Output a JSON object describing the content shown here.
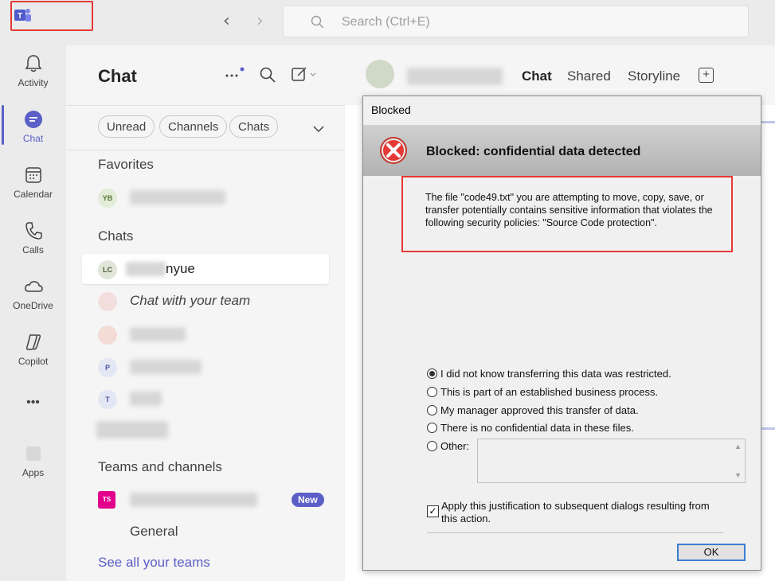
{
  "titlebar": {
    "search_placeholder": "Search (Ctrl+E)",
    "back_arrow": "‹",
    "forward_arrow": "›"
  },
  "rail": {
    "items": [
      {
        "label": "Activity",
        "icon": "bell-icon"
      },
      {
        "label": "Chat",
        "icon": "chat-icon"
      },
      {
        "label": "Calendar",
        "icon": "calendar-icon"
      },
      {
        "label": "Calls",
        "icon": "phone-icon"
      },
      {
        "label": "OneDrive",
        "icon": "cloud-icon"
      },
      {
        "label": "Copilot",
        "icon": "copilot-icon"
      },
      {
        "label": "Apps",
        "icon": "apps-icon"
      }
    ],
    "more": "•••"
  },
  "panel": {
    "title": "Chat",
    "filters": [
      "Unread",
      "Channels",
      "Chats"
    ],
    "favorites_header": "Favorites",
    "chats_header": "Chats",
    "teams_header": "Teams and channels",
    "favorites": [
      {
        "initials": "YB",
        "name": ""
      }
    ],
    "chats": [
      {
        "initials": "LC",
        "name": "nyue"
      },
      {
        "initials": "",
        "name": "Chat with your team"
      },
      {
        "initials": "",
        "name": ""
      },
      {
        "initials": "P",
        "name": ""
      },
      {
        "initials": "T",
        "name": ""
      },
      {
        "initials": "",
        "name": ""
      }
    ],
    "team": {
      "initials": "TS",
      "badge": "New",
      "channel": "General"
    },
    "see_all": "See all your teams"
  },
  "main": {
    "tabs": [
      "Chat",
      "Shared",
      "Storyline"
    ],
    "add_tab": "+"
  },
  "dialog": {
    "title": "Blocked",
    "heading": "Blocked: confidential data detected",
    "message": "The file \"code49.txt\" you are attempting to move, copy, save, or transfer potentially contains sensitive information that violates the following security policies: \"Source Code protection\".",
    "options": [
      {
        "label": "I did not know transferring this data was restricted.",
        "checked": true
      },
      {
        "label": "This is part of an established business process.",
        "checked": false
      },
      {
        "label": "My manager approved this transfer of data.",
        "checked": false
      },
      {
        "label": "There is no confidential data in these files.",
        "checked": false
      },
      {
        "label": "Other:",
        "checked": false
      }
    ],
    "apply_label": "Apply this justification to subsequent dialogs resulting from this action.",
    "apply_checked": true,
    "ok_label": "OK"
  }
}
